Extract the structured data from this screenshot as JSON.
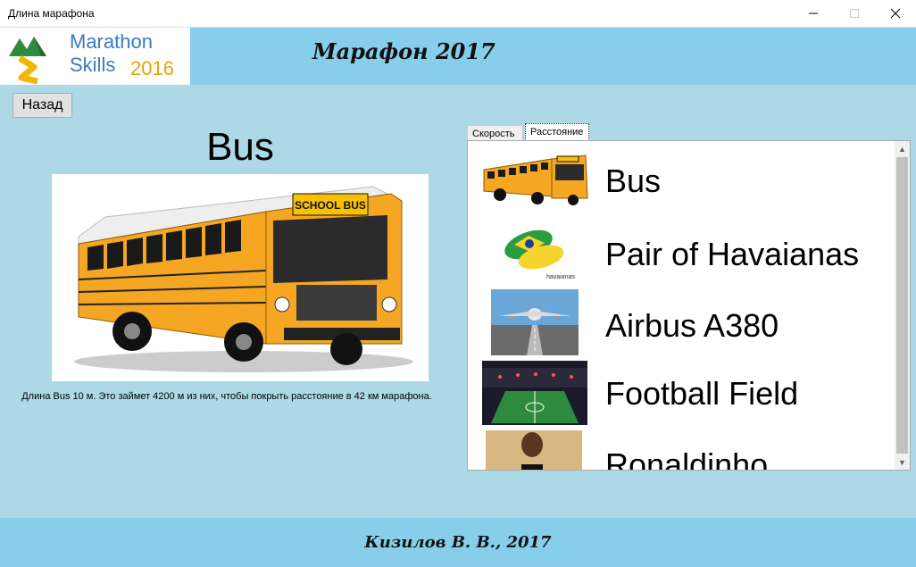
{
  "window": {
    "title": "Длина марафона"
  },
  "header": {
    "logo_line1": "Marathon",
    "logo_line2": "Skills",
    "logo_year": "2016",
    "title": "Марафон 2017"
  },
  "back_button": {
    "label": "Назад"
  },
  "selected": {
    "title": "Bus",
    "description": "Длина Bus 10 м. Это займет 4200 м из них, чтобы покрыть расстояние в 42 км марафона.",
    "bus_sign": "SCHOOL BUS"
  },
  "tabs": [
    {
      "label": "Скорость",
      "active": false
    },
    {
      "label": "Расстояние",
      "active": true
    }
  ],
  "list": [
    {
      "label": "Bus",
      "icon": "bus-thumbnail"
    },
    {
      "label": "Pair of Havaianas",
      "icon": "havaianas-thumbnail",
      "brand": "havaianas"
    },
    {
      "label": "Airbus A380",
      "icon": "airbus-thumbnail"
    },
    {
      "label": "Football Field",
      "icon": "football-field-thumbnail"
    },
    {
      "label": "Ronaldinho",
      "icon": "ronaldinho-thumbnail"
    }
  ],
  "footer": {
    "text": "Кизилов В. В., 2017"
  },
  "colors": {
    "background": "#ADD8E6",
    "header": "#87CEEB",
    "bus_yellow": "#F5A623"
  }
}
